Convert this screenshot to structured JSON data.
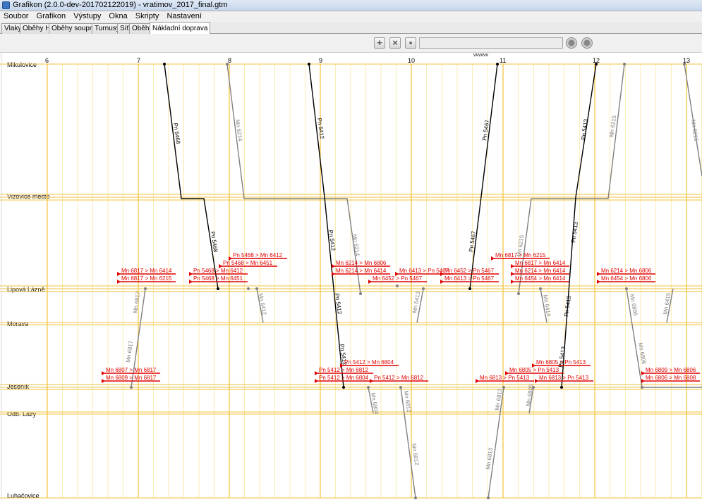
{
  "window": {
    "title": "Grafikon (2.0.0-dev-201702122019) - vratimov_2017_final.gtm"
  },
  "menu": [
    "Soubor",
    "Grafikon",
    "Výstupy",
    "Okna",
    "Skripty",
    "Nastavení"
  ],
  "tabs": [
    {
      "label": "Vlaky"
    },
    {
      "label": "Oběhy HV"
    },
    {
      "label": "Oběhy souprav"
    },
    {
      "label": "Turnusy"
    },
    {
      "label": "Síť"
    },
    {
      "label": "Oběhy"
    },
    {
      "label": "Nákladní doprava",
      "active": true
    }
  ],
  "toolbar": {
    "icons": [
      "plus-icon",
      "cross-icon",
      "document-icon"
    ],
    "text_field": ""
  },
  "graph": {
    "hours": [
      "6",
      "7",
      "8",
      "9",
      "10",
      "11",
      "12",
      "13"
    ],
    "marker": "vvvvvv",
    "stations": [
      {
        "name": "Mikulovice"
      },
      {
        "name": "Vizovice město"
      },
      {
        "name": "Lipová Lázně"
      },
      {
        "name": "Morava"
      },
      {
        "name": "Jeseník"
      },
      {
        "name": "Odb. Lazy"
      },
      {
        "name": "Luhačovice"
      }
    ],
    "trains": [
      {
        "label": "Pn 5468",
        "label2": "Pn 5468",
        "color": "#000000"
      },
      {
        "label": "Mn 6214",
        "label2": "Mn 6214",
        "color": "#808080"
      },
      {
        "label": "Pn 5412",
        "label2": "Pn 5412",
        "label3": "Pn 5412",
        "label4": "Pn 5412",
        "color": "#000000"
      },
      {
        "label": "Pn 5467",
        "label2": "Pn 5467",
        "color": "#000000"
      },
      {
        "label": "Mn 6215",
        "label2": "Mn 6215",
        "color": "#808080"
      },
      {
        "label": "Pn 5413",
        "label2": "Pn 5413",
        "label3": "Pn 5413",
        "label4": "Pn 5413",
        "color": "#000000"
      },
      {
        "label": "Mn 6216",
        "color": "#808080"
      },
      {
        "label": "Mn 6817",
        "label2": "Mn 6817",
        "color": "#808080"
      },
      {
        "label": "Mn 6412",
        "color": "#808080"
      },
      {
        "label": "Mn 6413",
        "color": "#808080"
      },
      {
        "label": "Mn 6414",
        "color": "#808080"
      },
      {
        "label": "Mn 6806",
        "label2": "Mn 6806",
        "color": "#808080"
      },
      {
        "label": "Mn 6415",
        "color": "#808080"
      },
      {
        "label": "Mn 6804",
        "color": "#808080"
      },
      {
        "label": "Mn 6812",
        "label2": "Mn 6812",
        "color": "#808080"
      },
      {
        "label": "Mn 6813",
        "label2": "Mn 6813",
        "color": "#808080"
      },
      {
        "label": "Mn 6805",
        "color": "#808080"
      }
    ],
    "freight_labels": [
      "Pn 5468 > Mn 6412",
      "Pn 5468 > Mn 6451",
      "Mn 6817 > Mn 6414",
      "Mn 6817 > Mn 6215",
      "Pn 5468 > Mn 6412",
      "Pn 5468 > Mn 6451",
      "Mn 6214 > Mn 6806",
      "Mn 6214 > Mn 6414",
      "Mn 6413 > Pn 5467",
      "Mn 6452 > Pn 5467",
      "Mn 6452 > Pn 5467",
      "Mn 6413 > Pn 5467",
      "Mn 6817 > Mn 6215",
      "Mn 6817 > Mn 6414",
      "Mn 6214 > Mn 6414",
      "Mn 6454 > Mn 6414",
      "Mn 6214 > Mn 6806",
      "Mn 6454 > Mn 6806",
      "Mn 6807 > Mn 6817",
      "Mn 6809 > Mn 6817",
      "Pn 5412 > Mn 6804",
      "Pn 5412 > Mn 6812",
      "Pn 5412 > Mn 6804",
      "Pn 5412 > Mn 6812",
      "Mn 6805 > Pn 5413",
      "Mn 6805 > Pn 5413",
      "Mn 6813 > Pn 5413",
      "Mn 6813 > Pn 5413",
      "Mn 6809 > Mn 6806",
      "Mn 6806 > Mn 6808"
    ]
  }
}
